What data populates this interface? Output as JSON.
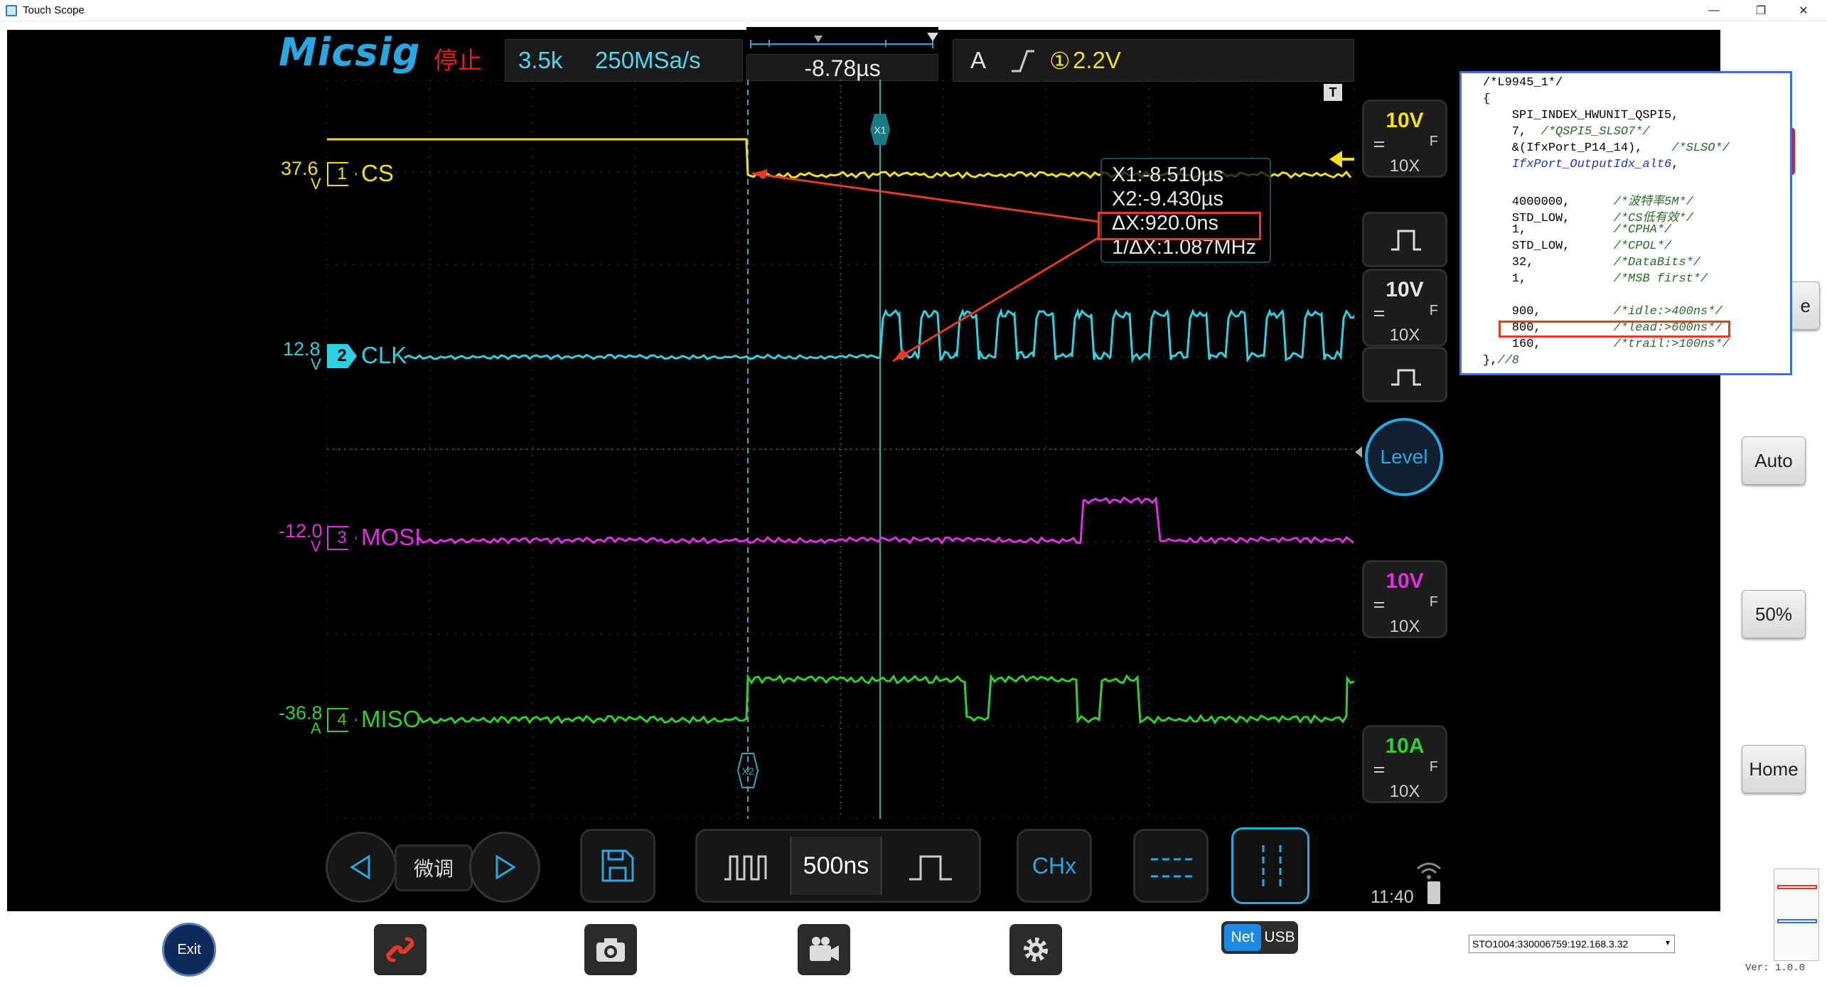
{
  "window": {
    "title": "Touch Scope",
    "minimize": "—",
    "restore": "❐",
    "close": "✕"
  },
  "header": {
    "brand": "Micsig",
    "status": "停止",
    "memory_depth": "3.5k",
    "sample_rate": "250MSa/s",
    "time_position": "-8.78µs",
    "trigger_mode": "A",
    "trigger_channel": "①",
    "trigger_level": "2.2V"
  },
  "channels": [
    {
      "num": "1",
      "name": "CS",
      "offset": "37.6",
      "unit": "V",
      "color": "#f0e020",
      "scale": "10V",
      "probe": "10X",
      "coupling": "F"
    },
    {
      "num": "2",
      "name": "CLK",
      "offset": "12.8",
      "unit": "V",
      "color": "#2fd0e0",
      "scale": "10V",
      "probe": "10X",
      "coupling": "F"
    },
    {
      "num": "3",
      "name": "MOSI",
      "offset": "-12.0",
      "unit": "V",
      "color": "#e030e0",
      "scale": "10V",
      "probe": "10X",
      "coupling": "F"
    },
    {
      "num": "4",
      "name": "MISO",
      "offset": "-36.8",
      "unit": "A",
      "color": "#30d030",
      "scale": "10A",
      "probe": "10X",
      "coupling": "F"
    }
  ],
  "cursors": {
    "x1_marker": "X1",
    "x2_marker": "X2",
    "x1": "X1:-8.510µs",
    "x2": "X2:-9.430µs",
    "delta": "ΔX:920.0ns",
    "inv_delta": "1/ΔX:1.087MHz",
    "trigger_marker": "T"
  },
  "controls": {
    "fine_tune": "微调",
    "timebase": "500ns",
    "chx": "CHx",
    "level": "Level",
    "time": "11:40"
  },
  "side_buttons": {
    "auto": "Auto",
    "fifty": "50%",
    "home": "Home",
    "partial": "e"
  },
  "toolbar": {
    "exit": "Exit",
    "net": "Net",
    "usb": "USB",
    "device": "STO1004:330006759:192.168.3.32",
    "version": "Ver: 1.0.0"
  },
  "code_overlay": [
    {
      "code": "/*L9945_1*/",
      "comment": ""
    },
    {
      "code": "{",
      "comment": ""
    },
    {
      "code": "    SPI_INDEX_HWUNIT_QSPI5,",
      "comment": ""
    },
    {
      "code": "    7,  ",
      "comment": "/*QSPI5_SLSO7*/"
    },
    {
      "code": "    &(IfxPort_P14_14),    ",
      "comment": "/*SLSO*/"
    },
    {
      "code": "    ",
      "func": "IfxPort_OutputIdx_alt6",
      "tail": ","
    },
    {
      "code": "",
      "comment": ""
    },
    {
      "code": "    4000000,      ",
      "comment": "/*波特率5M*/"
    },
    {
      "code": "    STD_LOW,      ",
      "comment": "/*CS低有效*/"
    },
    {
      "code": "    1,            ",
      "comment": "/*CPHA*/"
    },
    {
      "code": "    STD_LOW,      ",
      "comment": "/*CPOL*/"
    },
    {
      "code": "    32,           ",
      "comment": "/*DataBits*/"
    },
    {
      "code": "    1,            ",
      "comment": "/*MSB first*/"
    },
    {
      "code": "",
      "comment": ""
    },
    {
      "code": "    900,          ",
      "comment": "/*idle:>400ns*/"
    },
    {
      "code": "    800,          ",
      "comment": "/*lead:>600ns*/"
    },
    {
      "code": "    160,          ",
      "comment": "/*trail:>100ns*/"
    },
    {
      "code": "},",
      "comment": "//8"
    }
  ],
  "colors": {
    "cs": "#f0e020",
    "clk": "#2fd0e0",
    "mosi": "#e030e0",
    "miso": "#30d030",
    "accent": "#2aa6e0",
    "annotation": "#e53a2a"
  }
}
